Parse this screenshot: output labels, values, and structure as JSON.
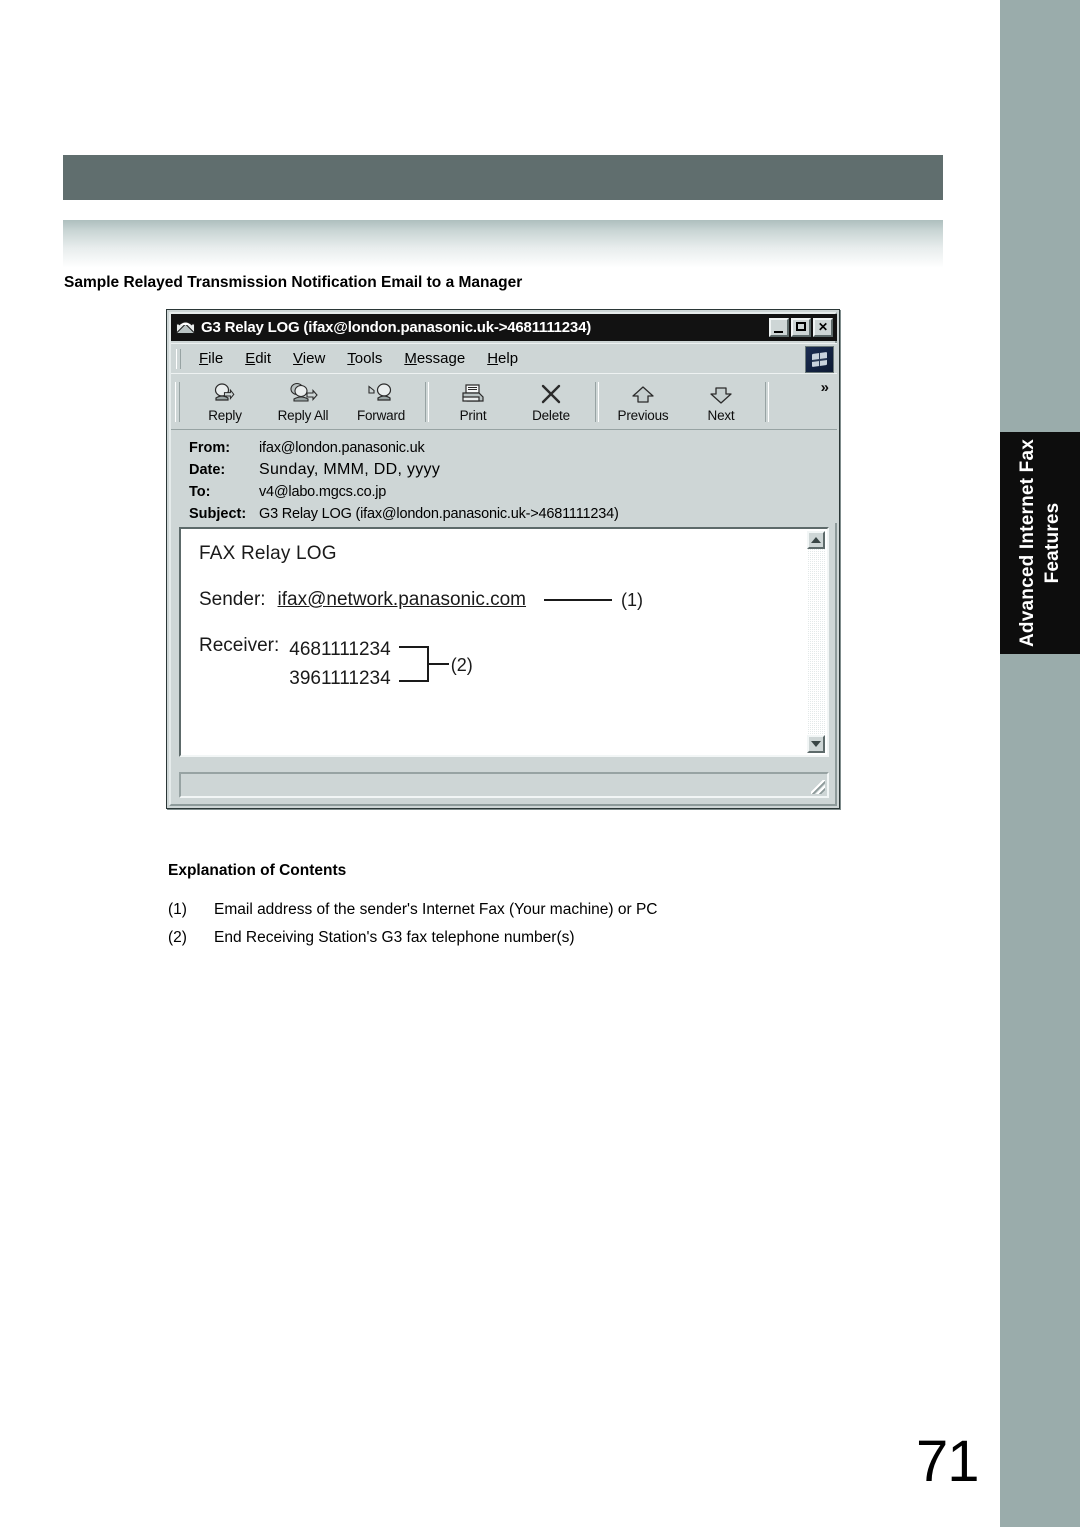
{
  "page": {
    "number": "71",
    "side_tab_line1": "Advanced Internet Fax",
    "side_tab_line2": "Features",
    "section_title": "Sample Relayed Transmission Notification Email to a Manager",
    "explanation_title": "Explanation of Contents",
    "explanations": [
      {
        "num": "(1)",
        "text": "Email address of the sender's Internet Fax (Your machine) or PC"
      },
      {
        "num": "(2)",
        "text": "End Receiving Station's G3 fax telephone number(s)"
      }
    ]
  },
  "window": {
    "icon": "envelope-icon",
    "title": "G3 Relay LOG (ifax@london.panasonic.uk->4681111234)",
    "controls": {
      "minimize": "minimize-button",
      "maximize": "maximize-button",
      "close": "close-button"
    },
    "menu": [
      {
        "accel": "F",
        "rest": "ile"
      },
      {
        "accel": "E",
        "rest": "dit"
      },
      {
        "accel": "V",
        "rest": "iew"
      },
      {
        "accel": "T",
        "rest": "ools"
      },
      {
        "accel": "M",
        "rest": "essage"
      },
      {
        "accel": "H",
        "rest": "elp"
      }
    ],
    "brand_icon": "windows-logo-icon",
    "toolbar": {
      "chevron": "»",
      "buttons": [
        {
          "label": "Reply",
          "icon": "reply-icon"
        },
        {
          "label": "Reply All",
          "icon": "reply-all-icon"
        },
        {
          "label": "Forward",
          "icon": "forward-icon"
        },
        {
          "label": "Print",
          "icon": "printer-icon"
        },
        {
          "label": "Delete",
          "icon": "delete-x-icon"
        },
        {
          "label": "Previous",
          "icon": "arrow-up-icon"
        },
        {
          "label": "Next",
          "icon": "arrow-down-icon"
        }
      ]
    },
    "headers": [
      {
        "key": "From:",
        "value": "ifax@london.panasonic.uk"
      },
      {
        "key": "Date:",
        "value": "Sunday,  MMM, DD, yyyy"
      },
      {
        "key": "To:",
        "value": "v4@labo.mgcs.co.jp"
      },
      {
        "key": "Subject:",
        "value": "G3 Relay LOG (ifax@london.panasonic.uk->4681111234)"
      }
    ],
    "body": {
      "title": "FAX Relay LOG",
      "sender_label": "Sender:",
      "sender_value": "ifax@network.panasonic.com",
      "sender_callout": "(1)",
      "receiver_label": "Receiver:",
      "receiver_values": [
        "4681111234",
        "3961111234"
      ],
      "receiver_callout": "(2)"
    },
    "scrollbar": {
      "up": "scroll-up-button",
      "down": "scroll-down-button"
    }
  }
}
